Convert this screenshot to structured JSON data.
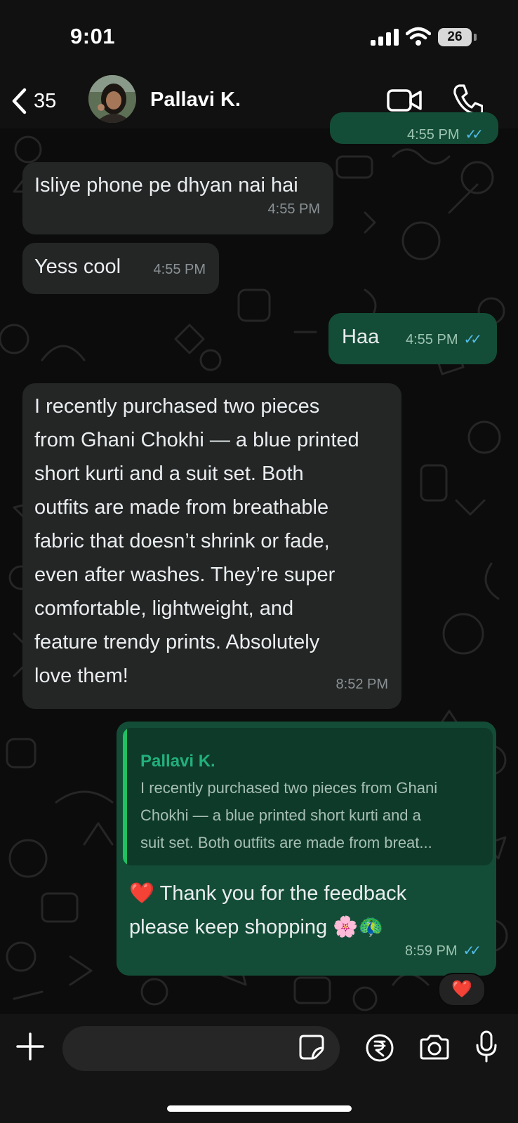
{
  "status": {
    "time": "9:01",
    "battery": "26"
  },
  "header": {
    "back_count": "35",
    "contact_name": "Pallavi K."
  },
  "messages": [
    {
      "dir": "out",
      "time": "4:55 PM"
    },
    {
      "dir": "in",
      "text": "Isliye phone pe dhyan nai hai",
      "time": "4:55 PM"
    },
    {
      "dir": "in",
      "text": "Yess cool",
      "time": "4:55 PM"
    },
    {
      "dir": "out",
      "text": "Haa",
      "time": "4:55 PM"
    },
    {
      "dir": "in",
      "text": "I recently purchased two pieces\nfrom Ghani Chokhi — a blue printed\nshort kurti and a suit set. Both\noutfits are made from breathable\nfabric that doesn’t shrink or fade,\neven after washes. They’re super\ncomfortable, lightweight, and\nfeature trendy prints. Absolutely\nlove them!",
      "time": "8:52 PM"
    },
    {
      "dir": "out",
      "quote": {
        "name": "Pallavi K.",
        "text": "I recently purchased two pieces from Ghani\nChokhi — a blue printed short kurti and a\nsuit set. Both outfits are made from breat..."
      },
      "text": "❤️ Thank you for the feedback\nplease keep shopping 🌸🦚",
      "time": "8:59 PM",
      "reaction": "❤️"
    }
  ],
  "composer": {
    "value": "",
    "placeholder": ""
  },
  "colors": {
    "incoming": "#242626",
    "outgoing": "#144d37",
    "read_ticks": "#53bdeb",
    "accent": "#21c063"
  },
  "icons": [
    "back-chevron",
    "video-camera",
    "phone",
    "plus",
    "sticker",
    "rupee",
    "camera",
    "microphone"
  ]
}
